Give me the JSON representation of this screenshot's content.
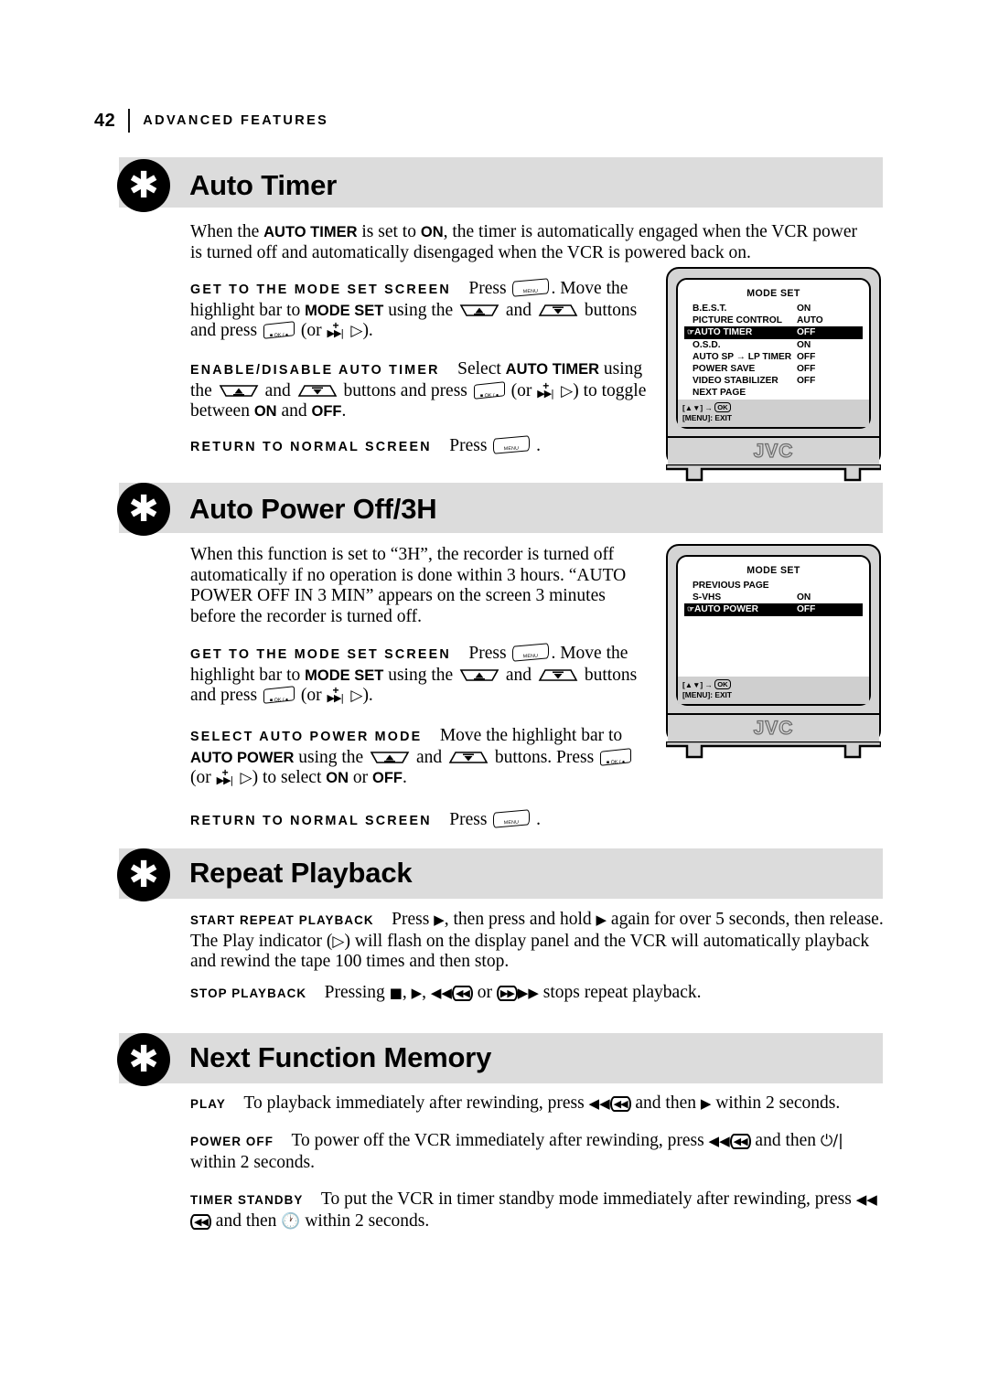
{
  "running_head": {
    "page_number": "42",
    "title": "ADVANCED FEATURES"
  },
  "icons": {
    "bullet": "asterisk-icon",
    "menu_button": "menu-remote-button-icon",
    "ok_button": "ok-remote-button-icon",
    "up_button": "up-rocker-button-icon",
    "down_button": "down-rocker-button-icon",
    "play_solid": "play-solid-icon",
    "play_hollow": "play-hollow-icon",
    "stop": "stop-icon",
    "rewind": "rewind-icon",
    "fast_forward": "fast-forward-icon",
    "power": "power-icon",
    "timer_clock": "timer-clock-icon"
  },
  "sections": [
    {
      "id": "auto-timer",
      "title": "Auto Timer",
      "intro": [
        {
          "t": "When the "
        },
        {
          "b": "AUTO TIMER"
        },
        {
          "t": " is set to "
        },
        {
          "b": "ON"
        },
        {
          "t": ", the timer is automatically engaged when the VCR power is turned off and automatically disengaged when the VCR is powered back on."
        }
      ],
      "steps": [
        {
          "label": "GET TO THE MODE SET SCREEN",
          "parts": [
            {
              "t": "Press "
            },
            {
              "i": "menu_button"
            },
            {
              "t": ". Move the highlight bar to "
            },
            {
              "b": "MODE SET"
            },
            {
              "t": " using the "
            },
            {
              "i": "up_button"
            },
            {
              "t": " and "
            },
            {
              "i": "down_button"
            },
            {
              "t": " buttons and press "
            },
            {
              "i": "ok_button"
            },
            {
              "t": " (or "
            },
            {
              "i": "plus_ff"
            },
            {
              "t": " "
            },
            {
              "i": "play_hollow"
            },
            {
              "t": ")."
            }
          ]
        },
        {
          "label": "ENABLE/DISABLE AUTO TIMER",
          "parts": [
            {
              "t": "Select "
            },
            {
              "b": "AUTO TIMER"
            },
            {
              "t": " using the "
            },
            {
              "i": "up_button"
            },
            {
              "t": " and "
            },
            {
              "i": "down_button"
            },
            {
              "t": " buttons and press "
            },
            {
              "i": "ok_button"
            },
            {
              "t": " (or "
            },
            {
              "i": "plus_ff"
            },
            {
              "t": " "
            },
            {
              "i": "play_hollow"
            },
            {
              "t": ") to toggle between "
            },
            {
              "b": "ON"
            },
            {
              "t": " and "
            },
            {
              "b": "OFF"
            },
            {
              "t": "."
            }
          ]
        },
        {
          "label": "RETURN TO NORMAL SCREEN",
          "parts": [
            {
              "t": "Press "
            },
            {
              "i": "menu_button"
            },
            {
              "t": " ."
            }
          ]
        }
      ],
      "tv": {
        "osd_title": "MODE SET",
        "rows": [
          {
            "name": "B.E.S.T.",
            "value": "ON",
            "highlight": false
          },
          {
            "name": "PICTURE CONTROL",
            "value": "AUTO",
            "highlight": false
          },
          {
            "name": "AUTO TIMER",
            "value": "OFF",
            "highlight": true
          },
          {
            "name": "O.S.D.",
            "value": "ON",
            "highlight": false
          },
          {
            "name": "AUTO SP → LP TIMER",
            "value": "OFF",
            "highlight": false
          },
          {
            "name": "POWER SAVE",
            "value": "OFF",
            "highlight": false
          },
          {
            "name": "VIDEO STABILIZER",
            "value": "OFF",
            "highlight": false
          },
          {
            "name": "NEXT PAGE",
            "value": "",
            "highlight": false
          }
        ],
        "blank_rows": 0,
        "footer_line1": "[▲▼] → OK",
        "footer_line2": "[MENU]: EXIT",
        "brand": "JVC"
      }
    },
    {
      "id": "auto-power-off",
      "title": "Auto Power Off/3H",
      "intro": [
        {
          "t": "When this function is set to “3H”, the recorder is turned off automatically if no operation is done within 3 hours. “AUTO POWER OFF IN 3 MIN” appears on the screen 3 minutes before the recorder is turned off."
        }
      ],
      "steps": [
        {
          "label": "GET TO THE MODE SET SCREEN",
          "parts": [
            {
              "t": "Press "
            },
            {
              "i": "menu_button"
            },
            {
              "t": ". Move the highlight bar to "
            },
            {
              "b": "MODE SET"
            },
            {
              "t": " using the "
            },
            {
              "i": "up_button"
            },
            {
              "t": " and "
            },
            {
              "i": "down_button"
            },
            {
              "t": " buttons and press "
            },
            {
              "i": "ok_button"
            },
            {
              "t": " (or "
            },
            {
              "i": "plus_ff"
            },
            {
              "t": " "
            },
            {
              "i": "play_hollow"
            },
            {
              "t": ")."
            }
          ]
        },
        {
          "label": "SELECT AUTO POWER MODE",
          "parts": [
            {
              "t": "Move the highlight bar to "
            },
            {
              "b": "AUTO POWER"
            },
            {
              "t": " using the "
            },
            {
              "i": "up_button"
            },
            {
              "t": " and "
            },
            {
              "i": "down_button"
            },
            {
              "t": " buttons. Press "
            },
            {
              "i": "ok_button"
            },
            {
              "t": " (or "
            },
            {
              "i": "plus_ff"
            },
            {
              "t": " "
            },
            {
              "i": "play_hollow"
            },
            {
              "t": ") to select "
            },
            {
              "b": "ON"
            },
            {
              "t": " or "
            },
            {
              "b": "OFF"
            },
            {
              "t": "."
            }
          ]
        },
        {
          "label": "RETURN TO NORMAL SCREEN",
          "parts": [
            {
              "t": "Press "
            },
            {
              "i": "menu_button"
            },
            {
              "t": " ."
            }
          ]
        }
      ],
      "tv": {
        "osd_title": "MODE SET",
        "rows": [
          {
            "name": "PREVIOUS PAGE",
            "value": "",
            "highlight": false
          },
          {
            "name": "S-VHS",
            "value": "ON",
            "highlight": false
          },
          {
            "name": "AUTO POWER",
            "value": "OFF",
            "highlight": true
          }
        ],
        "blank_rows": 5,
        "footer_line1": "[▲▼] → OK",
        "footer_line2": "[MENU]: EXIT",
        "brand": "JVC"
      }
    },
    {
      "id": "repeat-playback",
      "title": "Repeat Playback",
      "intro": [],
      "steps": [
        {
          "label": "START REPEAT PLAYBACK",
          "small": true,
          "parts": [
            {
              "t": "Press "
            },
            {
              "i": "play_solid"
            },
            {
              "t": ", then press and hold "
            },
            {
              "i": "play_solid"
            },
            {
              "t": " again for over 5 seconds, then release. The Play indicator ("
            },
            {
              "i": "play_hollow"
            },
            {
              "t": ") will flash on the display panel and the VCR will automatically playback and rewind the tape 100 times and then stop."
            }
          ]
        },
        {
          "label": "STOP PLAYBACK",
          "small": true,
          "parts": [
            {
              "t": "Pressing "
            },
            {
              "i": "stop"
            },
            {
              "t": ", "
            },
            {
              "i": "play_solid"
            },
            {
              "t": ", "
            },
            {
              "i": "rewind"
            },
            {
              "t": " or "
            },
            {
              "i": "fast_forward"
            },
            {
              "t": " stops repeat playback."
            }
          ]
        }
      ],
      "tv": null
    },
    {
      "id": "next-function-memory",
      "title": "Next Function Memory",
      "intro": [],
      "steps": [
        {
          "label": "PLAY",
          "small": true,
          "parts": [
            {
              "t": "To playback immediately after rewinding, press "
            },
            {
              "i": "rewind"
            },
            {
              "t": " and then "
            },
            {
              "i": "play_solid"
            },
            {
              "t": " within 2 seconds."
            }
          ]
        },
        {
          "label": "POWER OFF",
          "small": true,
          "parts": [
            {
              "t": "To power off the VCR immediately after rewinding, press "
            },
            {
              "i": "rewind"
            },
            {
              "t": " and then "
            },
            {
              "i": "power"
            },
            {
              "t": " within 2 seconds."
            }
          ]
        },
        {
          "label": "TIMER STANDBY",
          "small": true,
          "parts": [
            {
              "t": "To put the VCR in timer standby mode immediately after rewinding, press "
            },
            {
              "i": "rewind"
            },
            {
              "t": " and then "
            },
            {
              "i": "timer_clock"
            },
            {
              "t": " within 2 seconds."
            }
          ]
        }
      ],
      "tv": null
    }
  ]
}
